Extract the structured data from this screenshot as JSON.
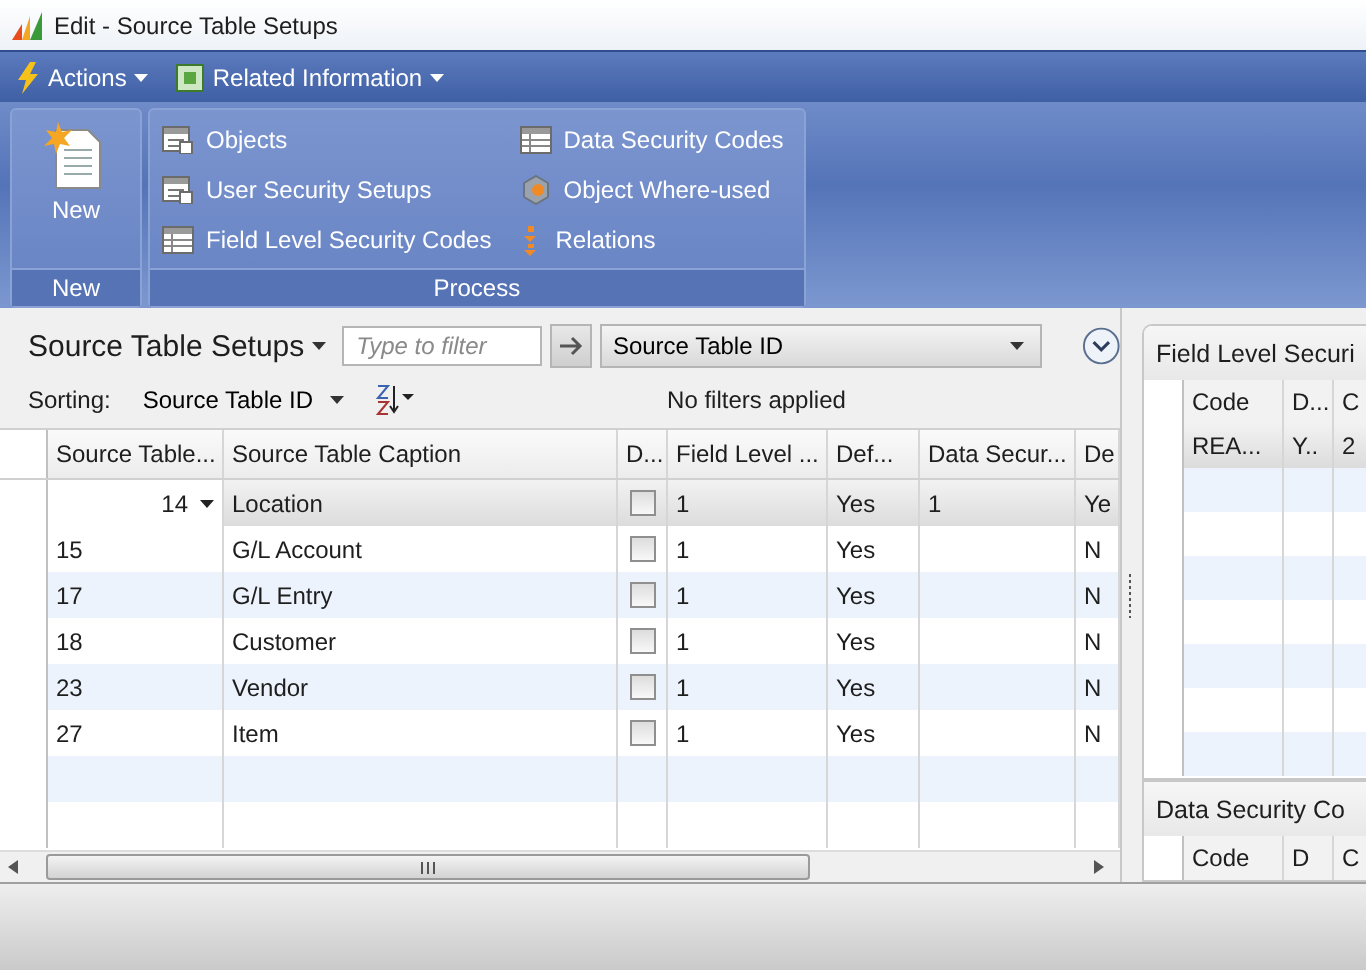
{
  "window": {
    "title": "Edit - Source Table Setups"
  },
  "menu": [
    {
      "label": "Actions"
    },
    {
      "label": "Related Information"
    }
  ],
  "ribbon": [
    {
      "title": "New",
      "items": [
        {
          "label": "New",
          "kind": "new"
        }
      ]
    },
    {
      "title": "Process",
      "items": [
        {
          "label": "Objects",
          "kind": "list"
        },
        {
          "label": "User Security Setups",
          "kind": "list"
        },
        {
          "label": "Field Level Security Codes",
          "kind": "table"
        },
        {
          "label": "Data Security Codes",
          "kind": "table"
        },
        {
          "label": "Object Where-used",
          "kind": "gear"
        },
        {
          "label": "Relations",
          "kind": "relations"
        }
      ]
    }
  ],
  "list": {
    "title": "Source Table Setups",
    "filter": {
      "placeholder": "Type to filter"
    },
    "filter_field": "Source Table ID",
    "sorting_label": "Sorting:",
    "sort_field": "Source Table ID",
    "status": "No filters applied"
  },
  "table": {
    "columns": [
      "Source Table...",
      "Source Table Caption",
      "D...",
      "Field Level ...",
      "Def...",
      "Data Secur...",
      "De"
    ],
    "rows": [
      {
        "selected": true,
        "id": "14",
        "caption": "Location",
        "checked": false,
        "field_level": "1",
        "def": "Yes",
        "data_security": "1",
        "de": "Ye"
      },
      {
        "selected": false,
        "id": "15",
        "caption": "G/L Account",
        "checked": false,
        "field_level": "1",
        "def": "Yes",
        "de": "N"
      },
      {
        "selected": false,
        "id": "17",
        "caption": "G/L Entry",
        "checked": false,
        "field_level": "1",
        "def": "Yes",
        "de": "N"
      },
      {
        "selected": false,
        "id": "18",
        "caption": "Customer",
        "checked": false,
        "field_level": "1",
        "def": "Yes",
        "de": "N"
      },
      {
        "selected": false,
        "id": "23",
        "caption": "Vendor",
        "checked": false,
        "field_level": "1",
        "def": "Yes",
        "de": "N"
      },
      {
        "selected": false,
        "id": "27",
        "caption": "Item",
        "checked": false,
        "field_level": "1",
        "def": "Yes",
        "de": "N"
      }
    ]
  },
  "factboxes": [
    {
      "title": "Field Level Securi",
      "columns": [
        "Code",
        "D...",
        "C"
      ],
      "rows": [
        {
          "selected": true,
          "cells": [
            "REA...",
            "Y..",
            "2"
          ]
        }
      ]
    },
    {
      "title": "Data Security Co",
      "columns": [
        "Code",
        "D",
        "C"
      ]
    }
  ]
}
